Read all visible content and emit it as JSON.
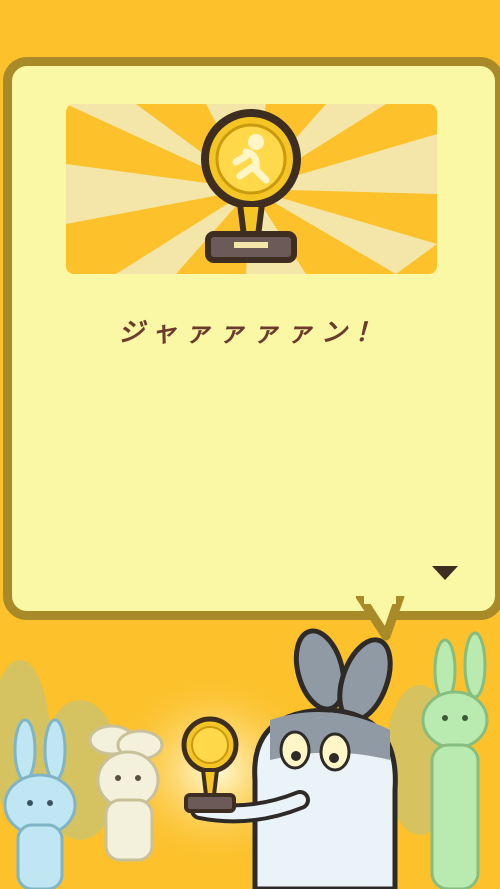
{
  "dialog": {
    "text": "ジャァァァァン！"
  },
  "icons": {
    "trophy": "trophy-icon",
    "next": "triangle-down-icon"
  },
  "colors": {
    "background": "#fcc12b",
    "dialog_fill": "#faf8a4",
    "dialog_border": "#a88b28",
    "text": "#6b3c2e",
    "gold": "#f5c623"
  }
}
